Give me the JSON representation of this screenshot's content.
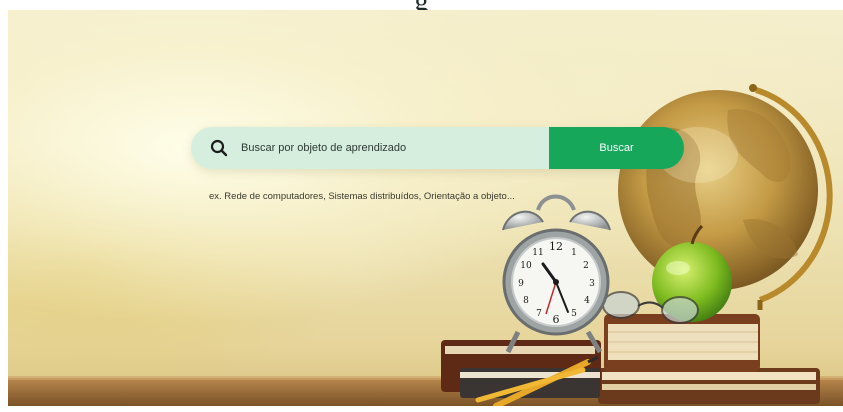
{
  "page": {
    "heading_fragment": "g"
  },
  "search": {
    "placeholder": "Buscar por objeto de aprendizado",
    "value": "",
    "button_label": "Buscar",
    "examples_hint": "ex. Rede de computadores, Sistemas distribuídos, Orientação a objeto..."
  },
  "icons": {
    "search": "search-icon"
  },
  "clock": {
    "numerals": [
      "12",
      "1",
      "2",
      "3",
      "4",
      "5",
      "6",
      "7",
      "8",
      "9",
      "10",
      "11"
    ]
  },
  "colors": {
    "search_field_bg": "#d5eede",
    "search_button_bg": "#16a75a",
    "search_button_text": "#ffffff"
  }
}
